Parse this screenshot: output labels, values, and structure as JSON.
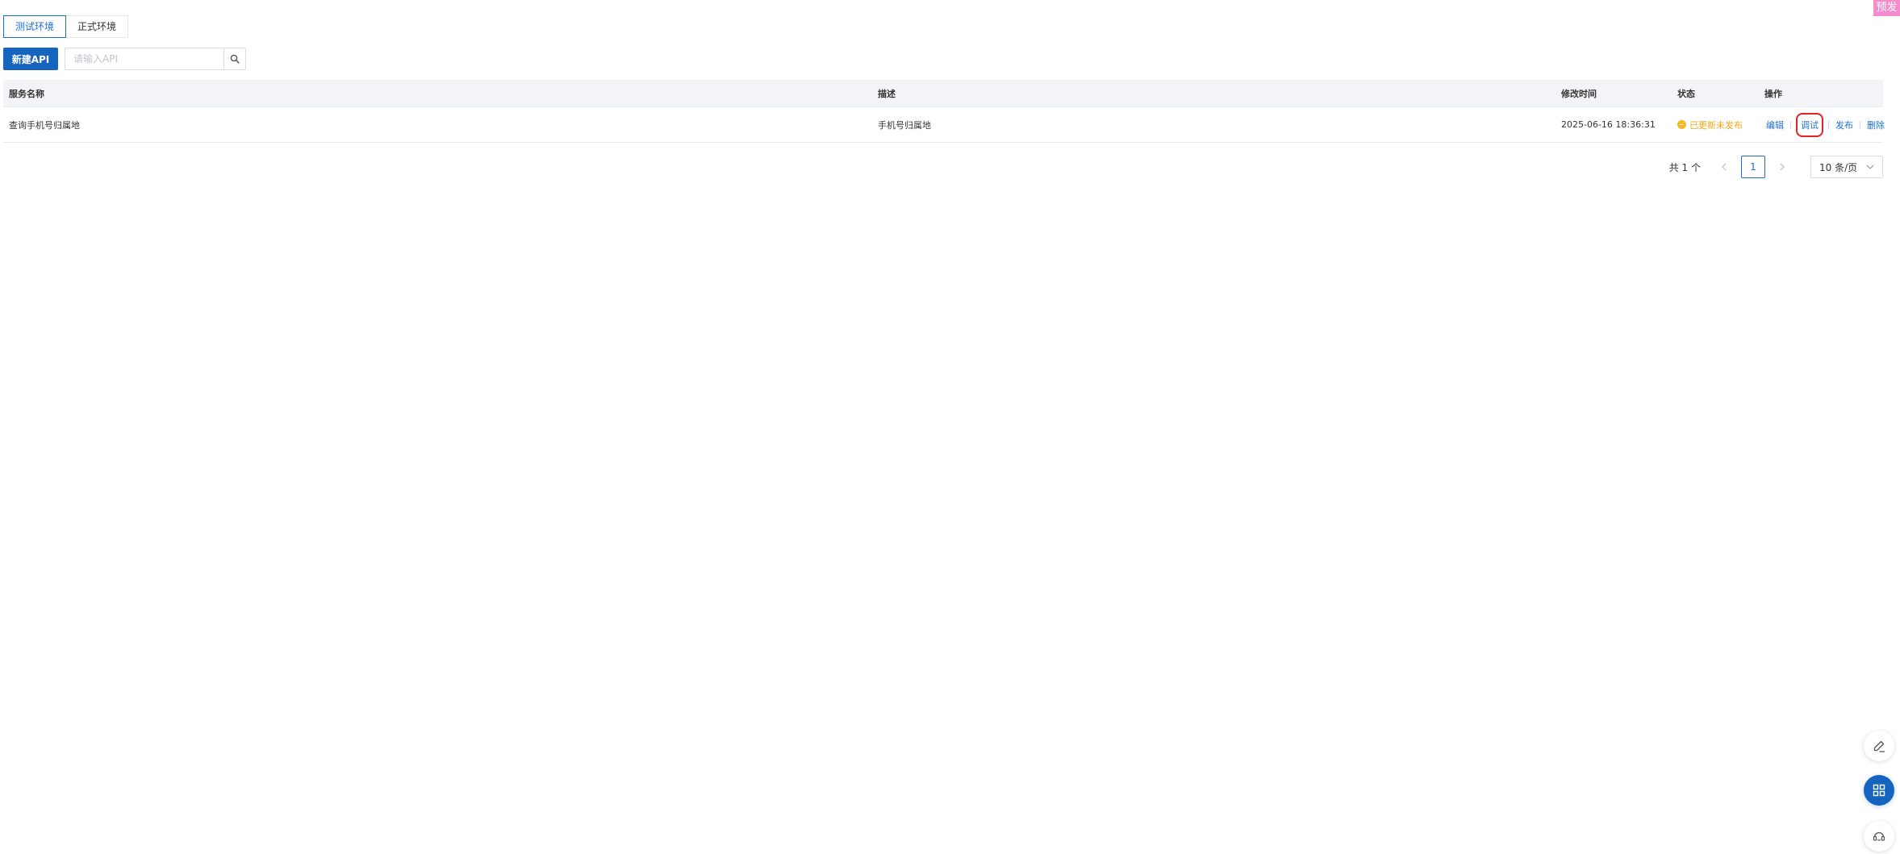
{
  "env_badge": "预发",
  "env_tabs": [
    {
      "label": "测试环境",
      "active": true
    },
    {
      "label": "正式环境",
      "active": false
    }
  ],
  "toolbar": {
    "new_api_label": "新建API",
    "search_placeholder": "请输入API"
  },
  "table": {
    "columns": {
      "name": "服务名称",
      "desc": "描述",
      "time": "修改时间",
      "status": "状态",
      "ops": "操作"
    },
    "rows": [
      {
        "name": "查询手机号归属地",
        "desc": "手机号归属地",
        "time": "2025-06-16 18:36:31",
        "status": "已更新未发布",
        "ops": {
          "edit": "编辑",
          "debug": "调试",
          "publish": "发布",
          "delete": "删除"
        }
      }
    ]
  },
  "pagination": {
    "total": "共 1 个",
    "current_page": "1",
    "page_size": "10 条/页"
  },
  "colors": {
    "primary": "#1565c0",
    "link": "#1f6fd1",
    "status_warning": "#f0a817",
    "badge": "#f58ccd",
    "highlight_ring": "#e02424"
  },
  "icons": [
    "search-icon",
    "chevron-left-icon",
    "chevron-right-icon",
    "chevron-down-icon",
    "edit-pen-icon",
    "grid-apps-icon",
    "customer-service-icon",
    "status-pending-icon"
  ]
}
